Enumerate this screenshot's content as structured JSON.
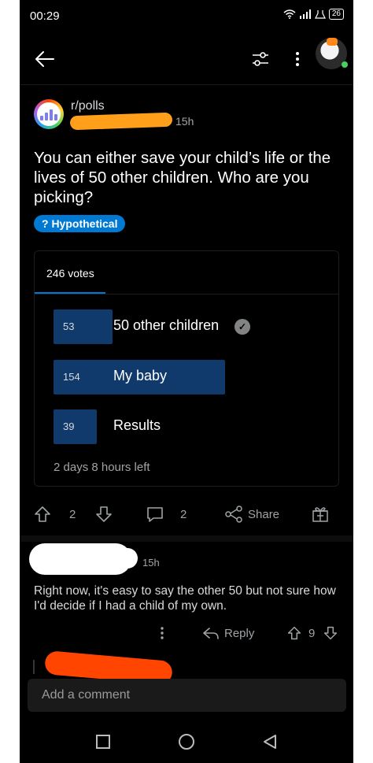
{
  "status_bar": {
    "time": "00:29",
    "battery": "26"
  },
  "post": {
    "subreddit": "r/polls",
    "age": "15h",
    "title": "You can either save your child’s life or the lives of 50 other children. Who are you picking?",
    "flair": "? Hypothetical"
  },
  "poll": {
    "votes_label": "246 votes",
    "options": [
      {
        "count": "53",
        "label": "50 other children",
        "share": 0.215,
        "selected": true
      },
      {
        "count": "154",
        "label": "My baby",
        "share": 0.626
      },
      {
        "count": "39",
        "label": "Results",
        "share": 0.159
      }
    ],
    "time_left": "2 days 8 hours left"
  },
  "actions": {
    "upvotes": "2",
    "comments": "2",
    "share_label": "Share"
  },
  "comment": {
    "age": "15h",
    "text": "Right now, it's easy to say the other 50 but not sure how I'd decide if I had a child of my own.",
    "reply_label": "Reply",
    "score": "9"
  },
  "composer": {
    "placeholder": "Add a comment"
  },
  "colors": {
    "accent": "#0079d3",
    "poll_fill": "#0f3a6b",
    "background": "#000000"
  }
}
